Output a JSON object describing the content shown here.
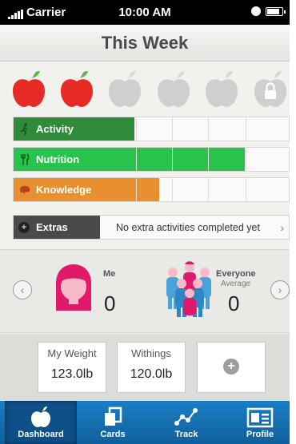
{
  "status_bar": {
    "carrier": "Carrier",
    "time": "10:00 AM"
  },
  "header": {
    "title": "This Week"
  },
  "apples": [
    {
      "state": "earned",
      "color": "#e62a25"
    },
    {
      "state": "earned",
      "color": "#e62a25"
    },
    {
      "state": "empty",
      "color": "#cfcfcd"
    },
    {
      "state": "empty",
      "color": "#cfcfcd"
    },
    {
      "state": "empty",
      "color": "#cfcfcd"
    },
    {
      "state": "locked",
      "color": "#cfcfcd"
    }
  ],
  "progress": {
    "activity": {
      "label": "Activity",
      "icon": "running-person-icon",
      "color": "#2f8a3a",
      "fill": 0.44
    },
    "nutrition": {
      "label": "Nutrition",
      "icon": "fork-knife-icon",
      "color": "#29c24a",
      "fill": 0.84
    },
    "knowledge": {
      "label": "Knowledge",
      "icon": "brain-icon",
      "color": "#e8902f",
      "fill": 0.53
    }
  },
  "extras": {
    "label": "Extras",
    "message": "No extra activities completed yet"
  },
  "compete": {
    "me_label": "Me",
    "me_score": "0",
    "everyone_label": "Everyone",
    "average_label": "Average",
    "everyone_score": "0"
  },
  "cards": [
    {
      "title": "My Weight",
      "value": "123.0lb"
    },
    {
      "title": "Withings",
      "value": "120.0lb"
    }
  ],
  "tabs": [
    {
      "label": "Dashboard",
      "icon": "apple-icon"
    },
    {
      "label": "Cards",
      "icon": "cards-icon"
    },
    {
      "label": "Track",
      "icon": "chart-icon"
    },
    {
      "label": "Profile",
      "icon": "profile-icon"
    }
  ]
}
